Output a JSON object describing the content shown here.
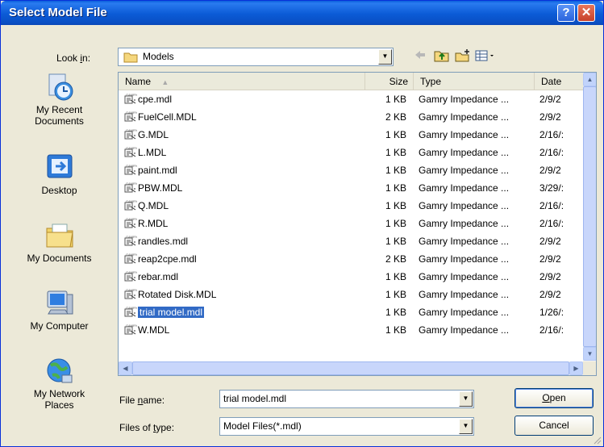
{
  "window": {
    "title": "Select Model File",
    "help_label": "?",
    "close_label": "✕"
  },
  "look_in": {
    "label_pre": "Look ",
    "label_key": "i",
    "label_post": "n:",
    "value": "Models"
  },
  "toolbar": {
    "icons": [
      "back-arrow-icon",
      "up-folder-icon",
      "new-folder-icon",
      "view-menu-icon"
    ]
  },
  "places": [
    {
      "label": "My Recent Documents",
      "icon": "recent-documents-icon"
    },
    {
      "label": "Desktop",
      "icon": "desktop-icon"
    },
    {
      "label": "My Documents",
      "icon": "my-documents-icon"
    },
    {
      "label": "My Computer",
      "icon": "my-computer-icon"
    },
    {
      "label": "My Network Places",
      "icon": "network-places-icon"
    }
  ],
  "columns": {
    "name": "Name",
    "size": "Size",
    "type": "Type",
    "date": "Date"
  },
  "files": [
    {
      "name": "cpe.mdl",
      "size": "1 KB",
      "type": "Gamry Impedance ...",
      "date": "2/9/2"
    },
    {
      "name": "FuelCell.MDL",
      "size": "2 KB",
      "type": "Gamry Impedance ...",
      "date": "2/9/2"
    },
    {
      "name": "G.MDL",
      "size": "1 KB",
      "type": "Gamry Impedance ...",
      "date": "2/16/:"
    },
    {
      "name": "L.MDL",
      "size": "1 KB",
      "type": "Gamry Impedance ...",
      "date": "2/16/:"
    },
    {
      "name": "paint.mdl",
      "size": "1 KB",
      "type": "Gamry Impedance ...",
      "date": "2/9/2"
    },
    {
      "name": "PBW.MDL",
      "size": "1 KB",
      "type": "Gamry Impedance ...",
      "date": "3/29/:"
    },
    {
      "name": "Q.MDL",
      "size": "1 KB",
      "type": "Gamry Impedance ...",
      "date": "2/16/:"
    },
    {
      "name": "R.MDL",
      "size": "1 KB",
      "type": "Gamry Impedance ...",
      "date": "2/16/:"
    },
    {
      "name": "randles.mdl",
      "size": "1 KB",
      "type": "Gamry Impedance ...",
      "date": "2/9/2"
    },
    {
      "name": "reap2cpe.mdl",
      "size": "2 KB",
      "type": "Gamry Impedance ...",
      "date": "2/9/2"
    },
    {
      "name": "rebar.mdl",
      "size": "1 KB",
      "type": "Gamry Impedance ...",
      "date": "2/9/2"
    },
    {
      "name": "Rotated Disk.MDL",
      "size": "1 KB",
      "type": "Gamry Impedance ...",
      "date": "2/9/2"
    },
    {
      "name": "trial model.mdl",
      "size": "1 KB",
      "type": "Gamry Impedance ...",
      "date": "1/26/:",
      "selected": true
    },
    {
      "name": "W.MDL",
      "size": "1 KB",
      "type": "Gamry Impedance ...",
      "date": "2/16/:"
    }
  ],
  "file_name": {
    "label_pre": "File ",
    "label_key": "n",
    "label_post": "ame:",
    "value": "trial model.mdl"
  },
  "file_type": {
    "label_pre": "Files of ",
    "label_key": "t",
    "label_post": "ype:",
    "value": "Model Files(*.mdl)"
  },
  "buttons": {
    "open_key": "O",
    "open_rest": "pen",
    "cancel": "Cancel"
  },
  "colors": {
    "title_bar": "#0a5fdc",
    "selection": "#316ac5",
    "dialog_bg": "#ece9d8"
  }
}
